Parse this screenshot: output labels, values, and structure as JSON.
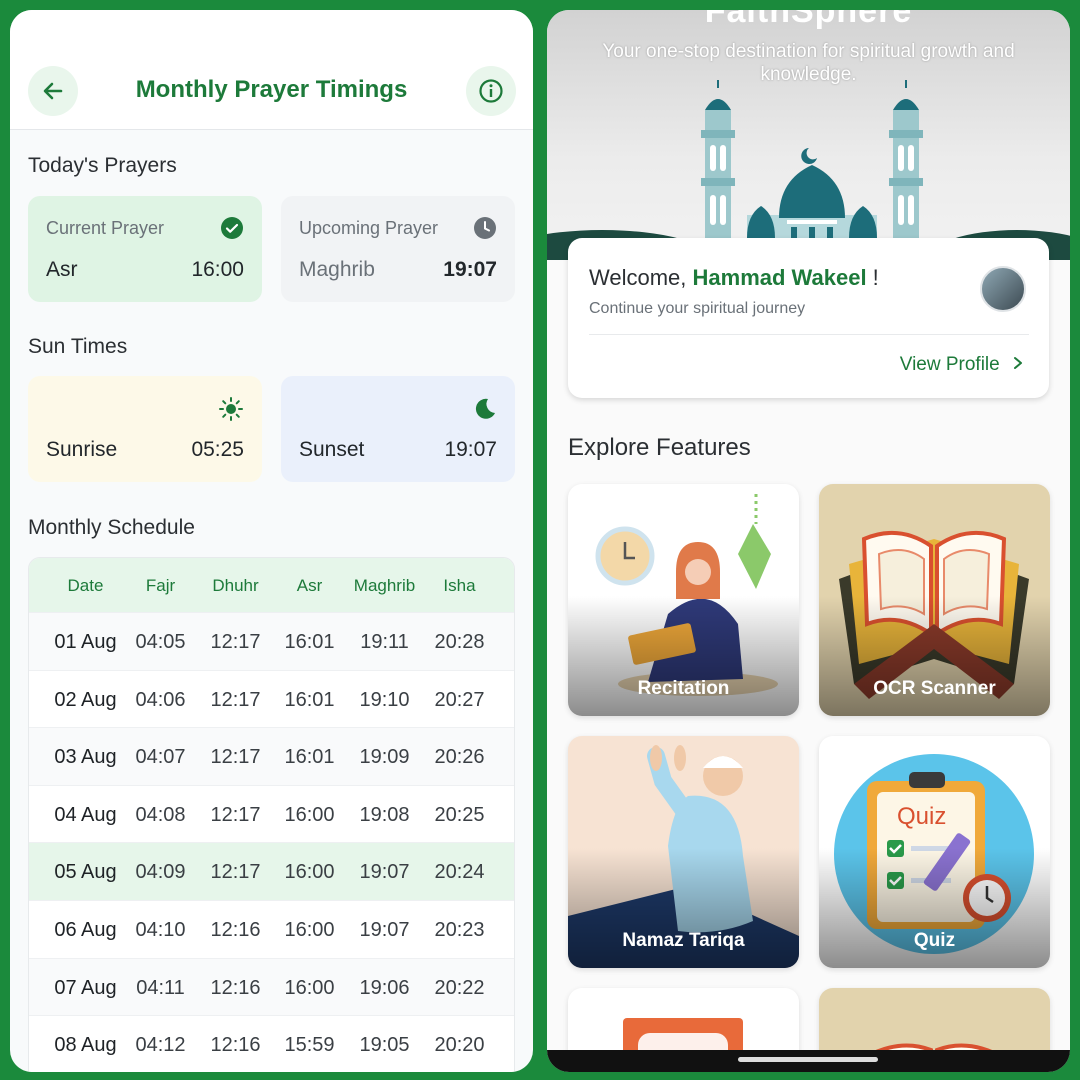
{
  "prayer": {
    "title": "Monthly Prayer Timings",
    "todays_prayers_title": "Today's Prayers",
    "current": {
      "label": "Current Prayer",
      "name": "Asr",
      "time": "16:00"
    },
    "upcoming": {
      "label": "Upcoming Prayer",
      "name": "Maghrib",
      "time": "19:07"
    },
    "sun_times_title": "Sun Times",
    "sunrise": {
      "name": "Sunrise",
      "time": "05:25"
    },
    "sunset": {
      "name": "Sunset",
      "time": "19:07"
    },
    "monthly_title": "Monthly Schedule",
    "columns": [
      "Date",
      "Fajr",
      "Dhuhr",
      "Asr",
      "Maghrib",
      "Isha"
    ],
    "rows": [
      [
        "01 Aug",
        "04:05",
        "12:17",
        "16:01",
        "19:11",
        "20:28"
      ],
      [
        "02 Aug",
        "04:06",
        "12:17",
        "16:01",
        "19:10",
        "20:27"
      ],
      [
        "03 Aug",
        "04:07",
        "12:17",
        "16:01",
        "19:09",
        "20:26"
      ],
      [
        "04 Aug",
        "04:08",
        "12:17",
        "16:00",
        "19:08",
        "20:25"
      ],
      [
        "05 Aug",
        "04:09",
        "12:17",
        "16:00",
        "19:07",
        "20:24"
      ],
      [
        "06 Aug",
        "04:10",
        "12:16",
        "16:00",
        "19:07",
        "20:23"
      ],
      [
        "07 Aug",
        "04:11",
        "12:16",
        "16:00",
        "19:06",
        "20:22"
      ],
      [
        "08 Aug",
        "04:12",
        "12:16",
        "15:59",
        "19:05",
        "20:20"
      ]
    ],
    "highlight_row": "05 Aug"
  },
  "home": {
    "app_name": "FaithSphere",
    "tagline": "Your one-stop destination for spiritual growth and knowledge.",
    "welcome_prefix": "Welcome, ",
    "user_name": "Hammad Wakeel",
    "welcome_suffix": " !",
    "welcome_sub": "Continue your spiritual journey",
    "view_profile": "View Profile",
    "explore_title": "Explore Features",
    "features": [
      "Recitation",
      "OCR Scanner",
      "Namaz Tariqa",
      "Quiz"
    ]
  },
  "colors": {
    "accent": "#1d7a3a",
    "frame": "#1b8a3c",
    "highlight": "#e6f6ea"
  }
}
